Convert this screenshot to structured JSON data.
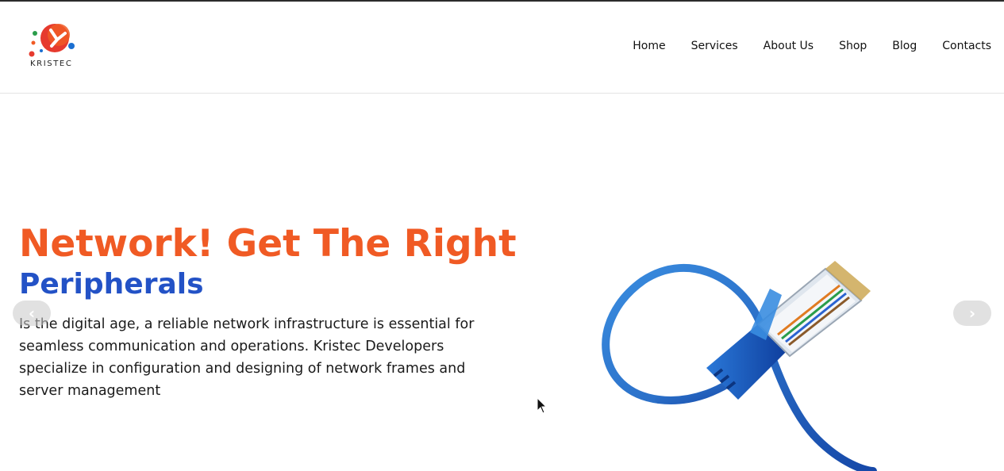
{
  "brand": {
    "name": "KRISTEC",
    "logo_icon": "kristec-logo",
    "colors": {
      "red": "#e63a2e",
      "orange": "#f05a24",
      "green": "#2a9d4a",
      "blue": "#1b6fd1"
    }
  },
  "nav": {
    "items": [
      {
        "label": "Home"
      },
      {
        "label": "Services"
      },
      {
        "label": "About Us"
      },
      {
        "label": "Shop"
      },
      {
        "label": "Blog"
      },
      {
        "label": "Contacts"
      }
    ]
  },
  "hero": {
    "title_line1": "Network! Get The Right",
    "title_line2": "Peripherals",
    "description": "Is the digital age, a reliable network infrastructure is essential for seamless communication and operations. Kristec Developers specialize in configuration and designing of network frames and server management",
    "title_color": "#f05a24",
    "subtitle_color": "#2352c6",
    "image_icon": "ethernet-cable-image",
    "prev_icon": "chevron-left-icon",
    "next_icon": "chevron-right-icon",
    "prev_glyph": "‹",
    "next_glyph": "›"
  }
}
